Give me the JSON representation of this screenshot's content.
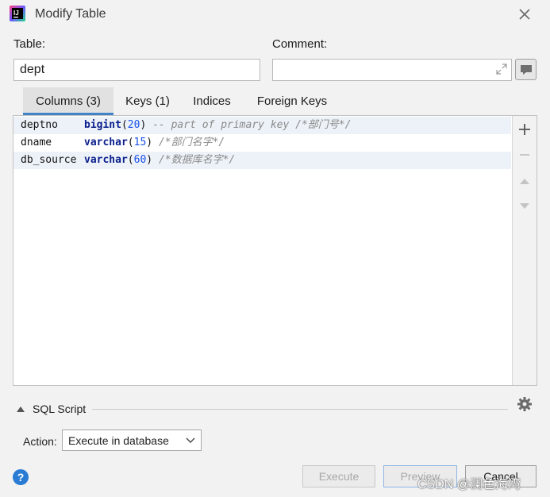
{
  "window": {
    "title": "Modify Table",
    "close_icon": "close-icon"
  },
  "form": {
    "table_label": "Table:",
    "table_value": "dept",
    "comment_label": "Comment:",
    "comment_value": ""
  },
  "tabs": [
    {
      "label": "Columns (3)",
      "active": true
    },
    {
      "label": "Keys (1)",
      "active": false
    },
    {
      "label": "Indices",
      "active": false
    },
    {
      "label": "Foreign Keys",
      "active": false
    }
  ],
  "columns": [
    {
      "name": "deptno",
      "type": "bigint",
      "size": "20",
      "comment": "-- part of primary key /*部门号*/"
    },
    {
      "name": "dname",
      "type": "varchar",
      "size": "15",
      "comment": "/*部门名字*/"
    },
    {
      "name": "db_source",
      "type": "varchar",
      "size": "60",
      "comment": "/*数据库名字*/"
    }
  ],
  "sql": {
    "label": "SQL Script",
    "action_label": "Action:",
    "action_value": "Execute in database"
  },
  "buttons": {
    "help": "?",
    "execute": "Execute",
    "preview": "Preview",
    "cancel": "Cancel"
  },
  "watermark": "CSDN @澜色海湾",
  "colors": {
    "accent": "#4083c9",
    "keyword": "#0a1e8c",
    "number": "#1750eb",
    "comment": "#8a8a8a",
    "help": "#2a7bd3"
  }
}
